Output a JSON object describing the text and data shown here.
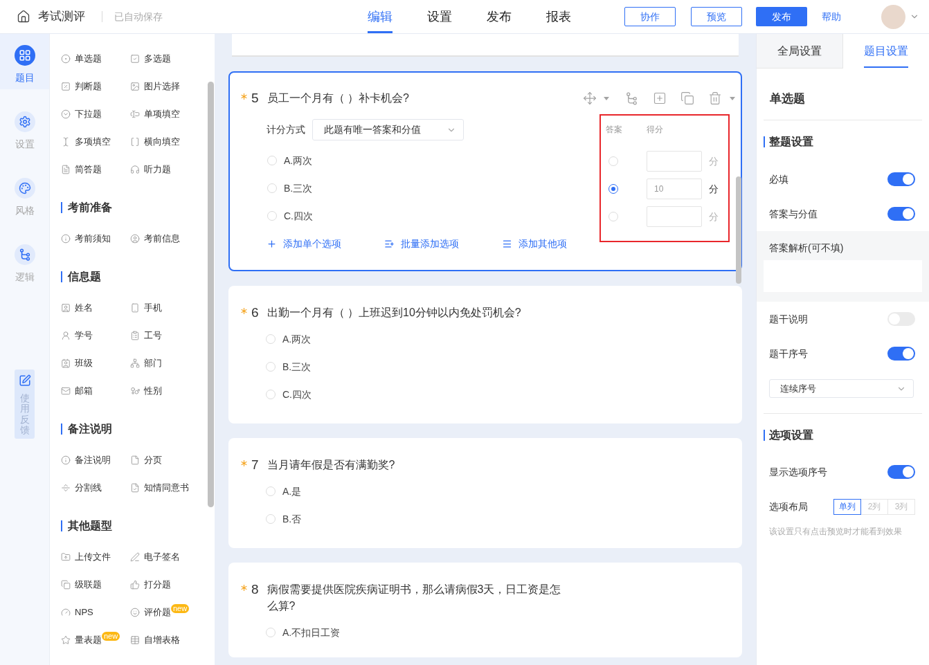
{
  "header": {
    "app_title": "考试测评",
    "save_status": "已自动保存",
    "tabs": [
      {
        "label": "编辑",
        "selected": true
      },
      {
        "label": "设置",
        "selected": false
      },
      {
        "label": "发布",
        "selected": false
      },
      {
        "label": "报表",
        "selected": false
      }
    ],
    "buttons": [
      {
        "label": "协作",
        "kind": "outline"
      },
      {
        "label": "预览",
        "kind": "outline"
      },
      {
        "label": "发布",
        "kind": "primary"
      },
      {
        "label": "帮助",
        "kind": "link"
      }
    ]
  },
  "rail": {
    "items": [
      {
        "label": "题目",
        "selected": true
      },
      {
        "label": "设置",
        "selected": false
      },
      {
        "label": "风格",
        "selected": false
      },
      {
        "label": "逻辑",
        "selected": false
      }
    ],
    "feedback": "使用反馈"
  },
  "widgets": {
    "sections": [
      {
        "items": [
          {
            "label": "单选题"
          },
          {
            "label": "多选题"
          },
          {
            "label": "判断题"
          },
          {
            "label": "图片选择"
          },
          {
            "label": "下拉题"
          },
          {
            "label": "单项填空"
          },
          {
            "label": "多项填空"
          },
          {
            "label": "横向填空"
          },
          {
            "label": "简答题"
          },
          {
            "label": "听力题"
          }
        ]
      },
      {
        "title": "考前准备",
        "items": [
          {
            "label": "考前须知"
          },
          {
            "label": "考前信息"
          }
        ]
      },
      {
        "title": "信息题",
        "items": [
          {
            "label": "姓名"
          },
          {
            "label": "手机"
          },
          {
            "label": "学号"
          },
          {
            "label": "工号"
          },
          {
            "label": "班级"
          },
          {
            "label": "部门"
          },
          {
            "label": "邮箱"
          },
          {
            "label": "性别"
          }
        ]
      },
      {
        "title": "备注说明",
        "items": [
          {
            "label": "备注说明"
          },
          {
            "label": "分页"
          },
          {
            "label": "分割线"
          },
          {
            "label": "知情同意书"
          }
        ]
      },
      {
        "title": "其他题型",
        "items": [
          {
            "label": "上传文件"
          },
          {
            "label": "电子签名"
          },
          {
            "label": "级联题"
          },
          {
            "label": "打分题"
          },
          {
            "label": "NPS"
          },
          {
            "label": "评价题",
            "badge": "new"
          },
          {
            "label": "量表题",
            "badge": "new"
          },
          {
            "label": "自增表格"
          }
        ]
      }
    ]
  },
  "editor": {
    "questions": [
      {
        "number": "5",
        "required": true,
        "active": true,
        "title": "员工一个月有（ ）补卡机会?",
        "scoring": {
          "label": "计分方式",
          "value": "此题有唯一答案和分值"
        },
        "options": [
          {
            "label": "A.两次",
            "selected": false
          },
          {
            "label": "B.三次",
            "selected": false
          },
          {
            "label": "C.四次",
            "selected": false
          }
        ],
        "answer_panel": {
          "highlighted": true,
          "headers": [
            "答案",
            "得分"
          ],
          "rows": [
            {
              "selected": false,
              "unit": "分"
            },
            {
              "selected": true,
              "score": "10",
              "unit": "分"
            },
            {
              "selected": false,
              "unit": "分"
            }
          ]
        },
        "add_actions": [
          {
            "label": "添加单个选项"
          },
          {
            "label": "批量添加选项"
          },
          {
            "label": "添加其他项"
          }
        ]
      },
      {
        "number": "6",
        "required": true,
        "active": false,
        "title": "出勤一个月有（ ）上班迟到10分钟以内免处罚机会?",
        "options": [
          {
            "label": "A.两次",
            "selected": false
          },
          {
            "label": "B.三次",
            "selected": false
          },
          {
            "label": "C.四次",
            "selected": false
          }
        ]
      },
      {
        "number": "7",
        "required": true,
        "active": false,
        "title": "当月请年假是否有满勤奖?",
        "options": [
          {
            "label": "A.是",
            "selected": false
          },
          {
            "label": "B.否",
            "selected": false
          }
        ]
      },
      {
        "number": "8",
        "required": true,
        "active": false,
        "title": "病假需要提供医院疾病证明书，那么请病假3天，日工资是怎么算?",
        "options": [
          {
            "label": "A.不扣日工资",
            "selected": false
          }
        ]
      }
    ]
  },
  "settings_panel": {
    "tabs": [
      {
        "label": "全局设置",
        "selected": false
      },
      {
        "label": "题目设置",
        "selected": true
      }
    ],
    "type_title": "单选题",
    "sections": [
      {
        "title": "整题设置",
        "rows": [
          {
            "kind": "toggle",
            "label": "必填",
            "on": true
          },
          {
            "kind": "toggle",
            "label": "答案与分值",
            "on": true
          },
          {
            "kind": "textarea",
            "label": "答案解析(可不填)"
          },
          {
            "kind": "toggle",
            "label": "题干说明",
            "on": false
          },
          {
            "kind": "toggle",
            "label": "题干序号",
            "on": true
          },
          {
            "kind": "select",
            "value": "连续序号"
          }
        ]
      },
      {
        "title": "选项设置",
        "rows": [
          {
            "kind": "toggle",
            "label": "显示选项序号",
            "on": true
          },
          {
            "kind": "segmented",
            "label": "选项布局",
            "options": [
              {
                "label": "单列",
                "selected": true
              },
              {
                "label": "2列",
                "selected": false
              },
              {
                "label": "3列",
                "selected": false
              }
            ]
          },
          {
            "kind": "note",
            "text": "该设置只有点击预览时才能看到效果"
          }
        ]
      }
    ]
  }
}
